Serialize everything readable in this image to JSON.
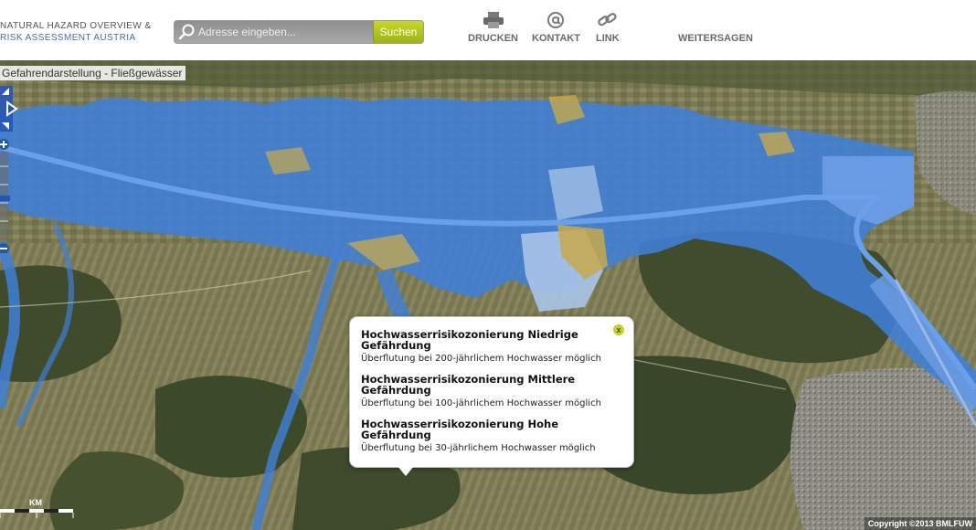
{
  "header": {
    "logo_line1": "NATURAL HAZARD OVERVIEW &",
    "logo_line2": "RISK ASSESSMENT AUSTRIA",
    "search_placeholder": "Adresse eingeben...",
    "search_button": "Suchen",
    "tools": [
      {
        "label": "DRUCKEN",
        "icon": "printer-icon"
      },
      {
        "label": "KONTAKT",
        "icon": "at-sign-icon"
      },
      {
        "label": "LINK",
        "icon": "chain-link-icon"
      },
      {
        "label": "WEITERSAGEN",
        "icon": ""
      }
    ]
  },
  "map": {
    "layer_title": "Gefahrendarstellung - Fließgewässer",
    "scale_label": "KM",
    "copyright": "Copyright ©2013 BMLFUW",
    "colors": {
      "hazard_blue": "#3f7fd8",
      "hazard_light": "#a8c4e8",
      "hazard_yellow": "#c8a94a",
      "terrain_green": "#4d5a33",
      "field_tan": "#8a8a5a"
    }
  },
  "popup": {
    "close_label": "x",
    "entries": [
      {
        "title": "Hochwasserrisikozonierung Niedrige Gefährdung",
        "desc": "Überflutung bei 200-jährlichem Hochwasser möglich"
      },
      {
        "title": "Hochwasserrisikozonierung Mittlere Gefährdung",
        "desc": "Überflutung bei 100-jährlichem Hochwasser möglich"
      },
      {
        "title": "Hochwasserrisikozonierung Hohe Gefährdung",
        "desc": "Überflutung bei 30-jährlichem Hochwasser möglich"
      }
    ]
  }
}
